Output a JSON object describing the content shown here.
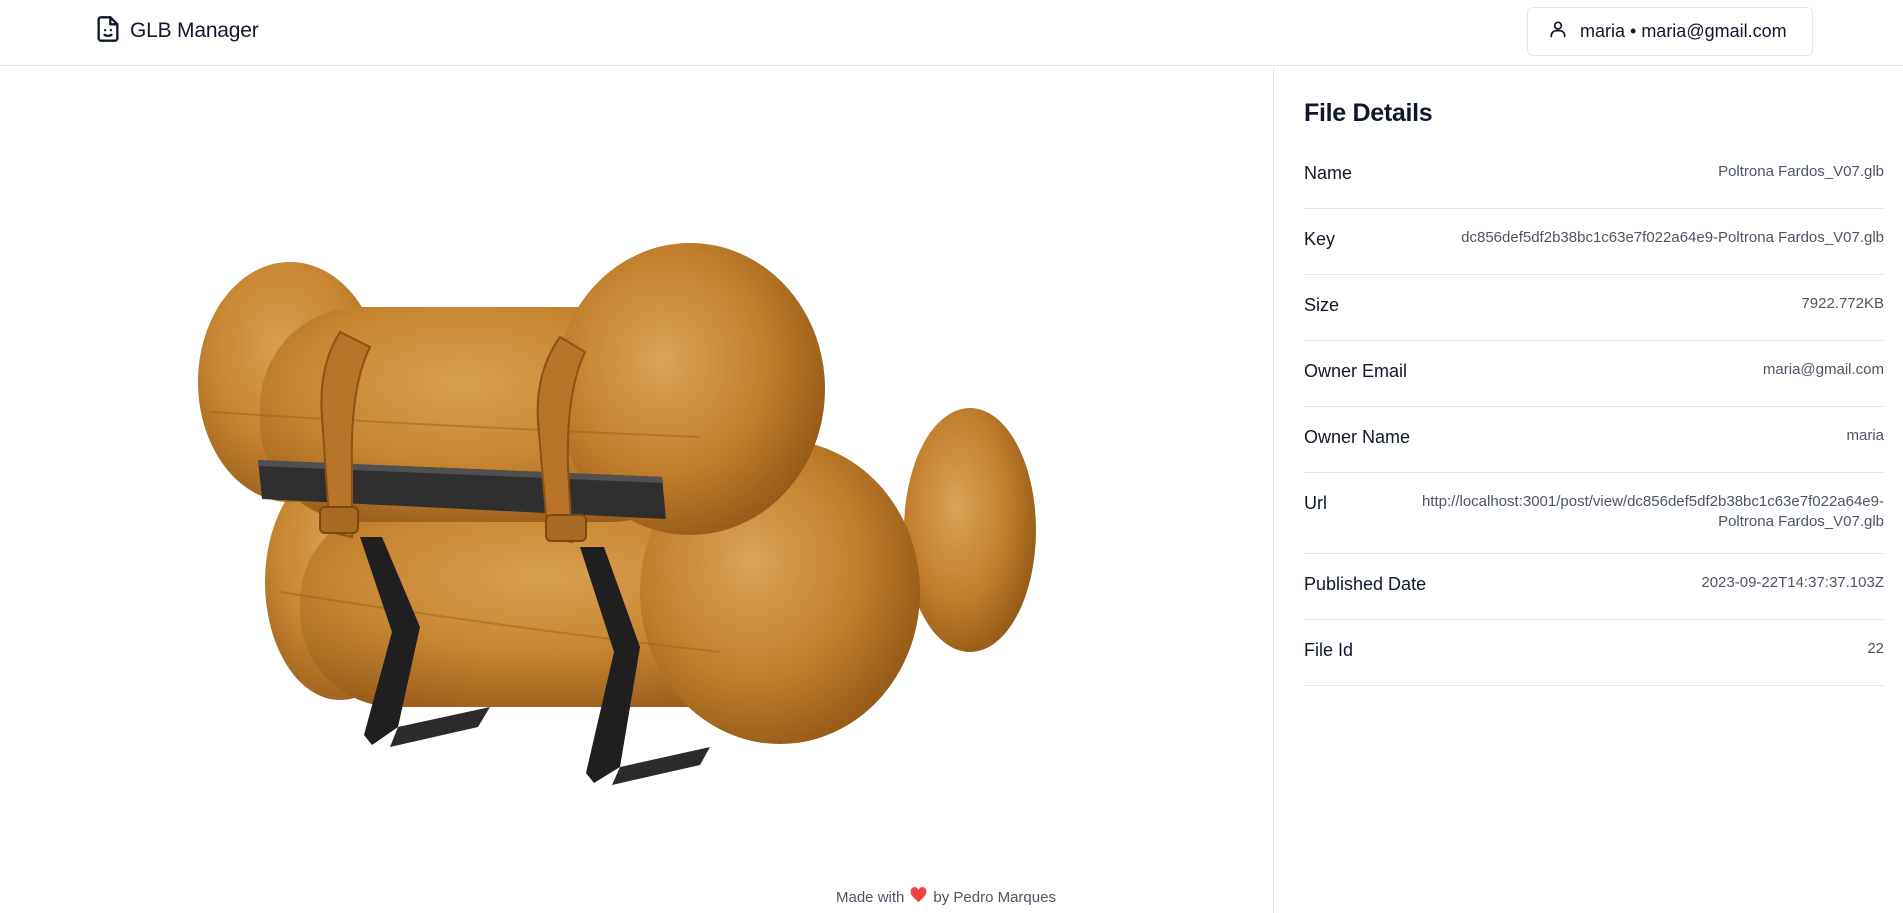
{
  "header": {
    "app_title": "GLB Manager",
    "user_label": "maria • maria@gmail.com"
  },
  "icons": {
    "brand": "file-smile-icon",
    "user": "user-icon",
    "heart": "heart-icon"
  },
  "colors": {
    "leather": "#c6842f",
    "frame": "#2b2b2b",
    "heart": "#ef4444",
    "border": "#e5e7eb"
  },
  "details": {
    "title": "File Details",
    "rows": [
      {
        "label": "Name",
        "value": "Poltrona Fardos_V07.glb"
      },
      {
        "label": "Key",
        "value": "dc856def5df2b38bc1c63e7f022a64e9-Poltrona Fardos_V07.glb"
      },
      {
        "label": "Size",
        "value": "7922.772KB"
      },
      {
        "label": "Owner Email",
        "value": "maria@gmail.com"
      },
      {
        "label": "Owner Name",
        "value": "maria"
      },
      {
        "label": "Url",
        "value_line1": "http://localhost:3001/post/view/dc856def5df2b38bc1c63e7f022a64e9-",
        "value_line2": "Poltrona Fardos_V07.glb"
      },
      {
        "label": "Published Date",
        "value": "2023-09-22T14:37:37.103Z"
      },
      {
        "label": "File Id",
        "value": "22"
      }
    ]
  },
  "footer": {
    "made_with": "Made with",
    "by": "by Pedro Marques"
  }
}
